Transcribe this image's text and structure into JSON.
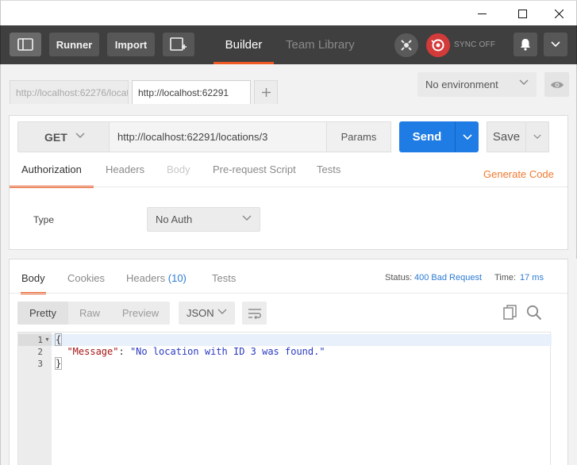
{
  "header": {
    "runner_label": "Runner",
    "import_label": "Import",
    "builder_label": "Builder",
    "team_library_label": "Team Library",
    "sync_label": "SYNC OFF"
  },
  "tabs": [
    {
      "label": "http://localhost:62276/locat"
    },
    {
      "label": "http://localhost:62291"
    }
  ],
  "environment": {
    "selected": "No environment"
  },
  "request": {
    "method": "GET",
    "url": "http://localhost:62291/locations/3",
    "params_label": "Params",
    "send_label": "Send",
    "save_label": "Save"
  },
  "request_tabs": [
    "Authorization",
    "Headers",
    "Body",
    "Pre-request Script",
    "Tests"
  ],
  "generate_code_label": "Generate Code",
  "auth": {
    "type_label": "Type",
    "selected": "No Auth"
  },
  "response_tabs": {
    "body": "Body",
    "cookies": "Cookies",
    "headers": "Headers",
    "headers_count": "(10)",
    "tests": "Tests"
  },
  "status": {
    "label": "Status:",
    "value": "400 Bad Request",
    "time_label": "Time:",
    "time_value": "17 ms"
  },
  "format": {
    "pretty": "Pretty",
    "raw": "Raw",
    "preview": "Preview",
    "language": "JSON"
  },
  "response_lines": [
    {
      "num": "1",
      "text": "{"
    },
    {
      "num": "2",
      "key": "\"Message\"",
      "sep": ": ",
      "value": "\"No location with ID 3 was found.\""
    },
    {
      "num": "3",
      "text": "}"
    }
  ],
  "colors": {
    "accent": "#ef5b25",
    "send": "#1f7ce5",
    "link": "#2b7bd6",
    "header_bg": "#3f3f3f"
  }
}
